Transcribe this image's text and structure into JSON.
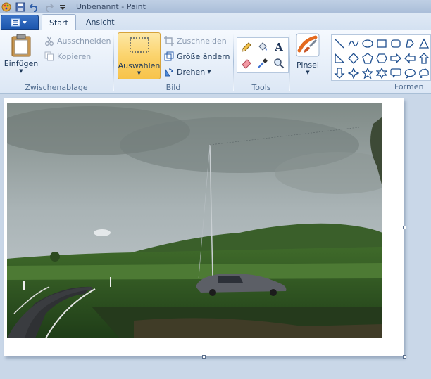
{
  "window": {
    "title": "Unbenannt - Paint"
  },
  "tabs": {
    "start": "Start",
    "view": "Ansicht"
  },
  "clipboard": {
    "paste_label": "Einfügen",
    "cut_label": "Ausschneiden",
    "copy_label": "Kopieren",
    "group_label": "Zwischenablage"
  },
  "image": {
    "select_label": "Auswählen",
    "crop_label": "Zuschneiden",
    "resize_label": "Größe ändern",
    "rotate_label": "Drehen",
    "group_label": "Bild"
  },
  "tools": {
    "group_label": "Tools",
    "items": [
      "pencil-icon",
      "fill-bucket-icon",
      "text-icon",
      "eraser-icon",
      "color-picker-icon",
      "magnifier-icon"
    ]
  },
  "brushes": {
    "label": "Pinsel"
  },
  "shapes": {
    "group_label": "Formen",
    "items": [
      "line",
      "curve",
      "oval",
      "rectangle",
      "rounded-rectangle",
      "polygon",
      "triangle",
      "right-triangle",
      "diamond",
      "pentagon",
      "hexagon",
      "right-arrow",
      "left-arrow",
      "up-arrow",
      "down-arrow",
      "four-point-star",
      "five-point-star",
      "six-point-star",
      "rounded-callout",
      "oval-callout",
      "cloud-callout"
    ]
  },
  "colors": {
    "accent": "#1c56ad",
    "selected_fill": "#fbd36c"
  }
}
